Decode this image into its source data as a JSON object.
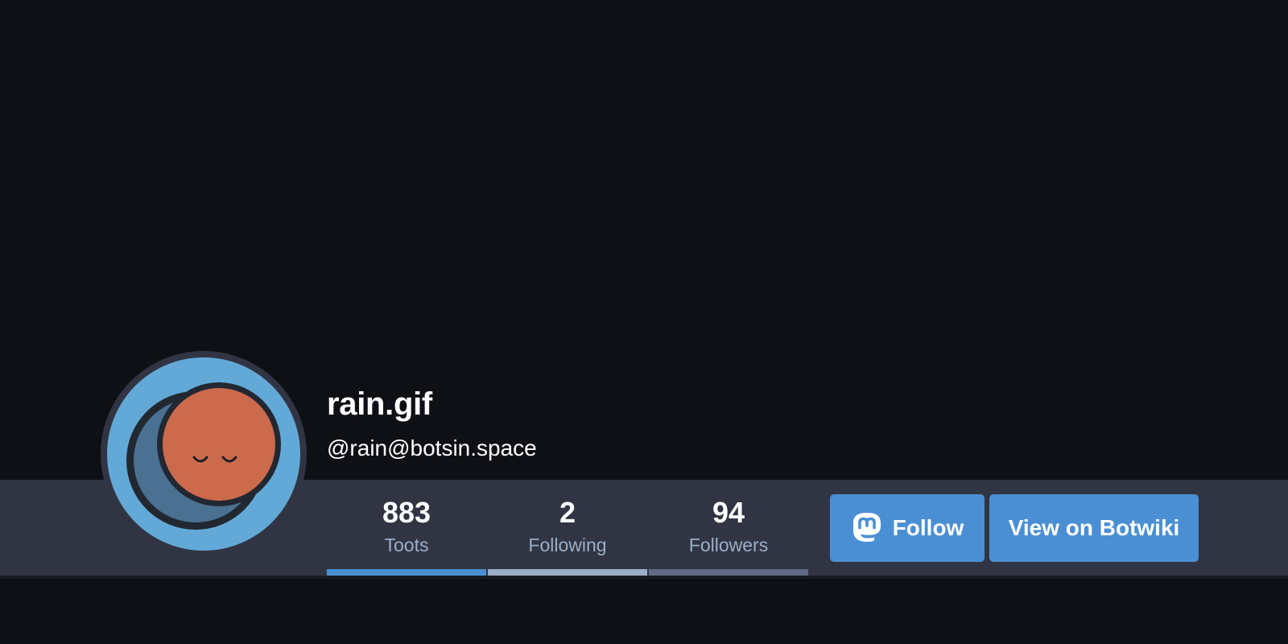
{
  "profile": {
    "display_name": "rain.gif",
    "handle": "@rain@botsin.space",
    "avatar": "moon-face-avatar"
  },
  "stats": [
    {
      "count": "883",
      "label": "Toots",
      "underline_color": "#4a8fd4"
    },
    {
      "count": "2",
      "label": "Following",
      "underline_color": "#9baec8"
    },
    {
      "count": "94",
      "label": "Followers",
      "underline_color": "#606984"
    }
  ],
  "actions": {
    "follow_label": "Follow",
    "follow_icon": "mastodon-icon",
    "botwiki_label": "View on Botwiki"
  },
  "colors": {
    "background": "#0f1015",
    "stats_bar": "#313543",
    "accent": "#4a8fd4",
    "avatar_bg": "#62a9d7",
    "moon": "#cc6a4c"
  }
}
